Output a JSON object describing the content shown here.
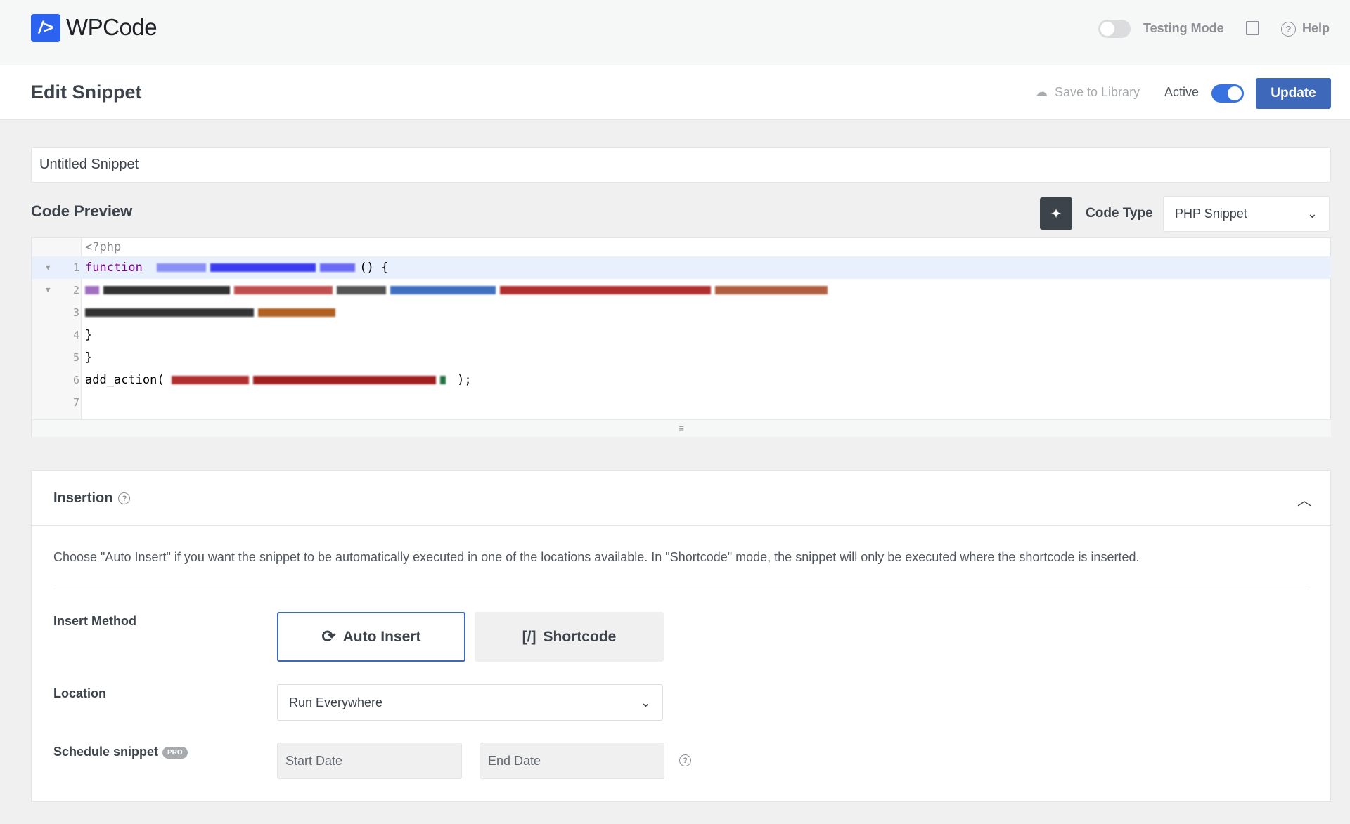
{
  "brand": {
    "logo_glyph": "/>",
    "name": "WPCode"
  },
  "topbar": {
    "testing_mode_label": "Testing Mode",
    "testing_mode_on": false,
    "help_label": "Help"
  },
  "editbar": {
    "title": "Edit Snippet",
    "save_to_library": "Save to Library",
    "active_label": "Active",
    "active_on": true,
    "update_label": "Update"
  },
  "snippet": {
    "title_value": "Untitled Snippet"
  },
  "code_preview": {
    "label": "Code Preview",
    "code_type_label": "Code Type",
    "code_type_value": "PHP Snippet",
    "lines": [
      {
        "num": "",
        "text": "<?php"
      },
      {
        "num": "1",
        "text": "function",
        "fold": true
      },
      {
        "num": "2",
        "text": "",
        "fold": true
      },
      {
        "num": "3",
        "text": ""
      },
      {
        "num": "4",
        "text": "}"
      },
      {
        "num": "5",
        "text": "}"
      },
      {
        "num": "6",
        "text": "add_action("
      },
      {
        "num": "7",
        "text": ""
      }
    ],
    "line6_end": ");",
    "line1_end": "() {"
  },
  "insertion": {
    "title": "Insertion",
    "description": "Choose \"Auto Insert\" if you want the snippet to be automatically executed in one of the locations available. In \"Shortcode\" mode, the snippet will only be executed where the shortcode is inserted.",
    "insert_method_label": "Insert Method",
    "auto_insert_label": "Auto Insert",
    "shortcode_label": "Shortcode",
    "shortcode_glyph": "[/]",
    "selected_method": "Auto Insert",
    "location_label": "Location",
    "location_value": "Run Everywhere",
    "schedule_label": "Schedule snippet",
    "pro_badge": "PRO",
    "start_date_placeholder": "Start Date",
    "end_date_placeholder": "End Date"
  },
  "colors": {
    "accent": "#3e68b9",
    "brand": "#2c62f0"
  }
}
